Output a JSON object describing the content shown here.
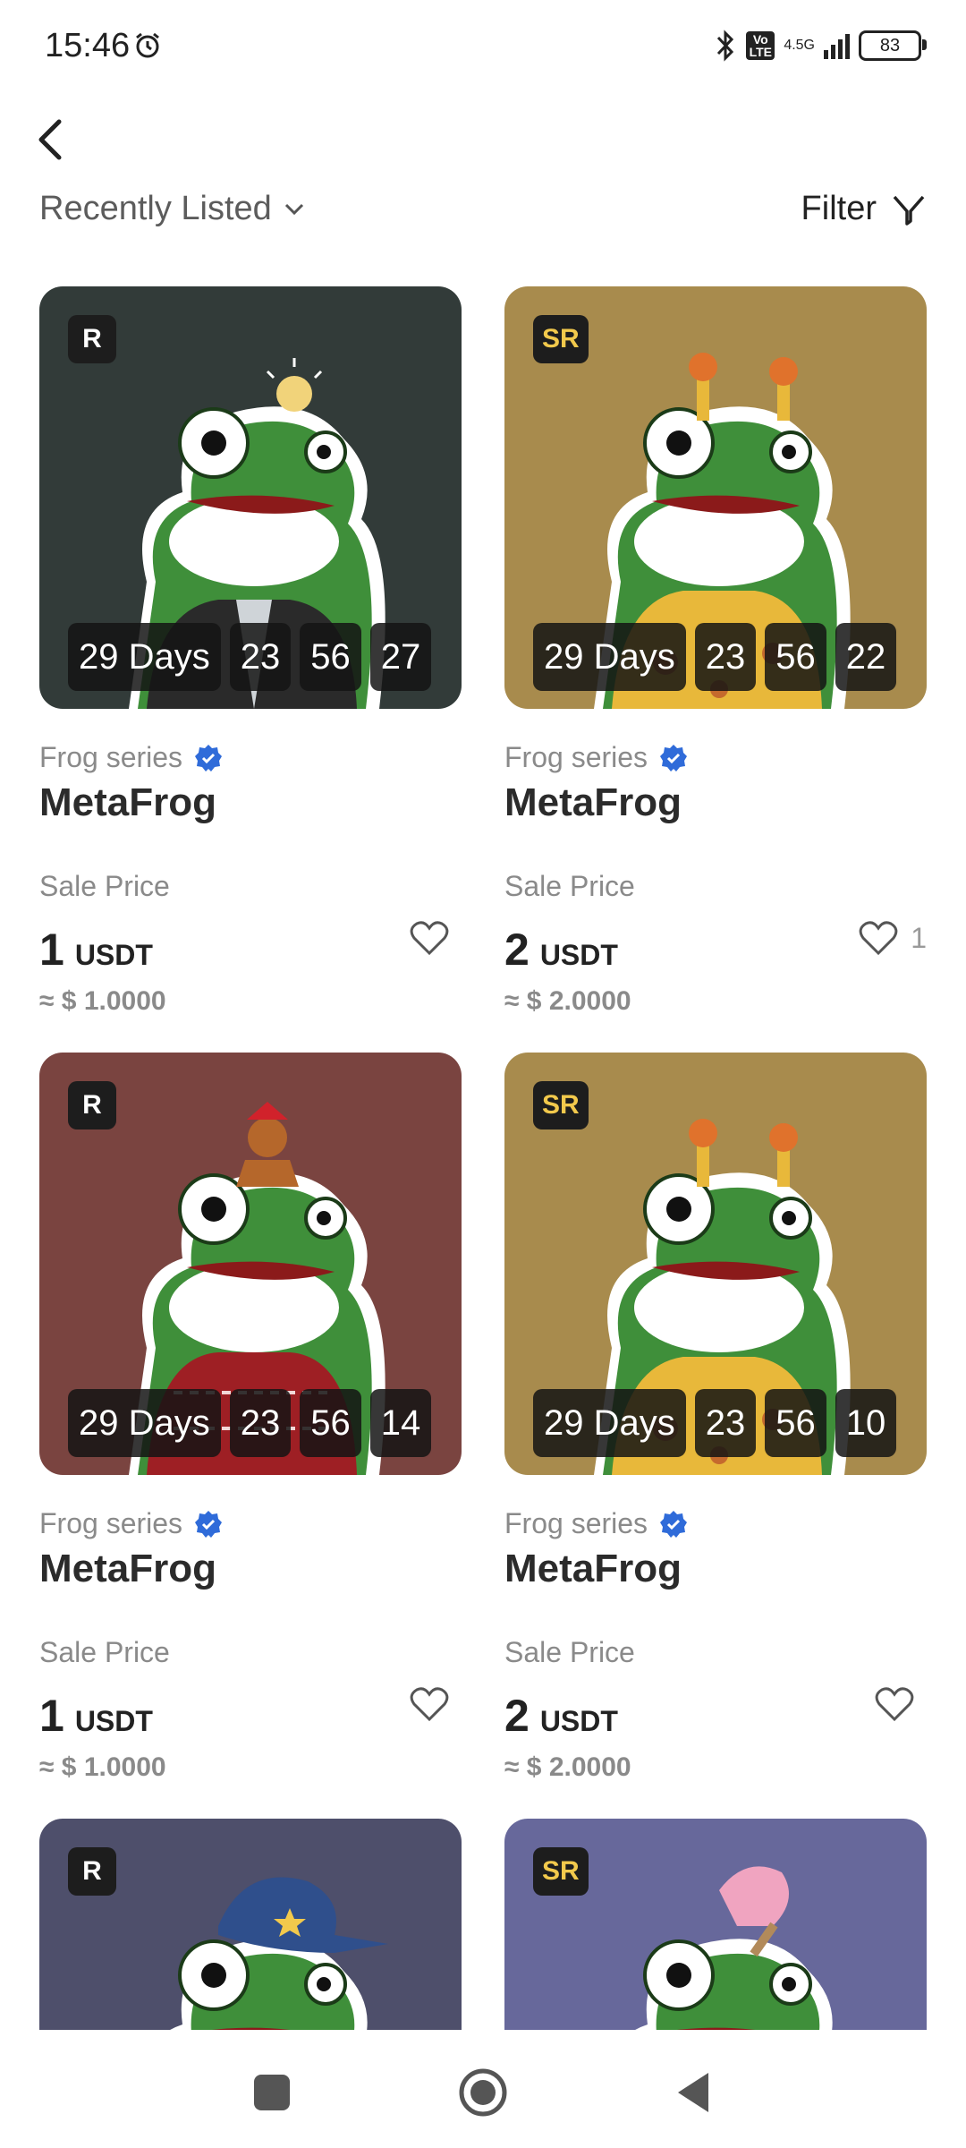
{
  "status_bar": {
    "time": "15:46",
    "network_type": "4.5G",
    "volte": "Vo LTE",
    "battery": "83"
  },
  "header": {
    "sort_label": "Recently Listed",
    "filter_label": "Filter"
  },
  "cards": [
    {
      "rarity": "R",
      "timer": [
        "29 Days",
        "23",
        "56",
        "27"
      ],
      "series": "Frog series",
      "name": "MetaFrog",
      "sale_label": "Sale Price",
      "price": "1",
      "unit": "USDT",
      "usd": "≈ $ 1.0000",
      "likes": "",
      "bg": "#323b39"
    },
    {
      "rarity": "SR",
      "timer": [
        "29 Days",
        "23",
        "56",
        "22"
      ],
      "series": "Frog series",
      "name": "MetaFrog",
      "sale_label": "Sale Price",
      "price": "2",
      "unit": "USDT",
      "usd": "≈ $ 2.0000",
      "likes": "1",
      "bg": "#a88b4d"
    },
    {
      "rarity": "R",
      "timer": [
        "29 Days",
        "23",
        "56",
        "14"
      ],
      "series": "Frog series",
      "name": "MetaFrog",
      "sale_label": "Sale Price",
      "price": "1",
      "unit": "USDT",
      "usd": "≈ $ 1.0000",
      "likes": "",
      "bg": "#7a4440"
    },
    {
      "rarity": "SR",
      "timer": [
        "29 Days",
        "23",
        "56",
        "10"
      ],
      "series": "Frog series",
      "name": "MetaFrog",
      "sale_label": "Sale Price",
      "price": "2",
      "unit": "USDT",
      "usd": "≈ $ 2.0000",
      "likes": "",
      "bg": "#a88b4d"
    },
    {
      "rarity": "R",
      "bg": "#4e4f6b"
    },
    {
      "rarity": "SR",
      "bg": "#67689b"
    }
  ],
  "colors": {
    "verify_blue": "#2f6bd9",
    "frog_green": "#3f8f3a"
  },
  "icons": [
    "back-arrow-icon",
    "chevron-down-icon",
    "filter-icon",
    "verified-icon",
    "heart-icon",
    "alarm-icon",
    "bluetooth-icon"
  ]
}
